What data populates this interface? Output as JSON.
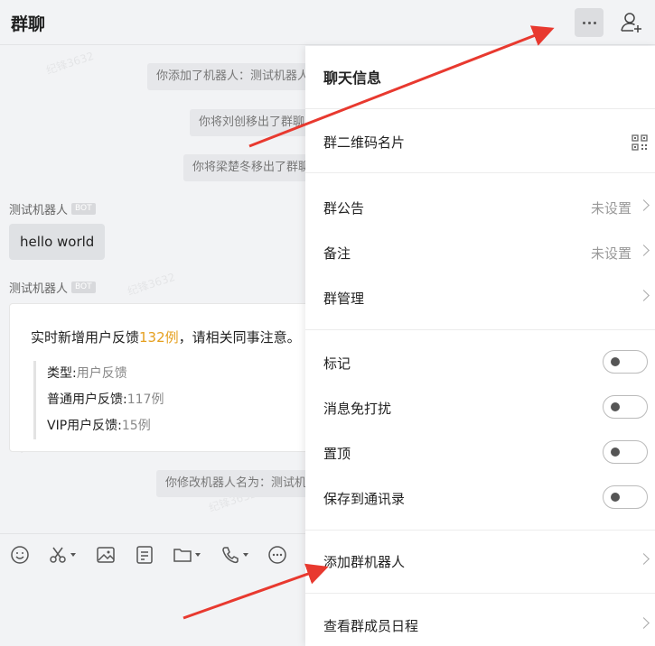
{
  "header": {
    "title": "群聊"
  },
  "chat": {
    "watermark": "纪锋3632",
    "system_messages": [
      "你添加了机器人：测试机器人",
      "你将刘创移出了群聊",
      "你将梁楚冬移出了群聊",
      "你修改机器人名为：测试机器人"
    ],
    "messages": [
      {
        "sender": "测试机器人",
        "tag": "BOT",
        "text": "hello world"
      },
      {
        "sender": "测试机器人",
        "tag": "BOT",
        "card": {
          "title_prefix": "实时新增用户反馈",
          "title_highlight": "132例",
          "title_suffix": "，请相关同事注意。",
          "lines": [
            {
              "key": "类型:",
              "value": "用户反馈"
            },
            {
              "key": "普通用户反馈:",
              "value": "117例"
            },
            {
              "key": "VIP用户反馈:",
              "value": "15例"
            }
          ]
        }
      }
    ]
  },
  "toolbar": {
    "icons": [
      "emoji-icon",
      "scissors-icon",
      "image-icon",
      "document-icon",
      "folder-icon",
      "phone-icon",
      "more-icon"
    ]
  },
  "panel": {
    "title": "聊天信息",
    "qr_label": "群二维码名片",
    "announcement_label": "群公告",
    "announcement_value": "未设置",
    "remark_label": "备注",
    "remark_value": "未设置",
    "manage_label": "群管理",
    "toggles": [
      {
        "label": "标记",
        "on": false
      },
      {
        "label": "消息免打扰",
        "on": false
      },
      {
        "label": "置顶",
        "on": false
      },
      {
        "label": "保存到通讯录",
        "on": false
      }
    ],
    "add_bot_label": "添加群机器人",
    "schedule_label": "查看群成员日程"
  },
  "colors": {
    "highlight": "#e5a020",
    "arrow": "#e8392f"
  }
}
